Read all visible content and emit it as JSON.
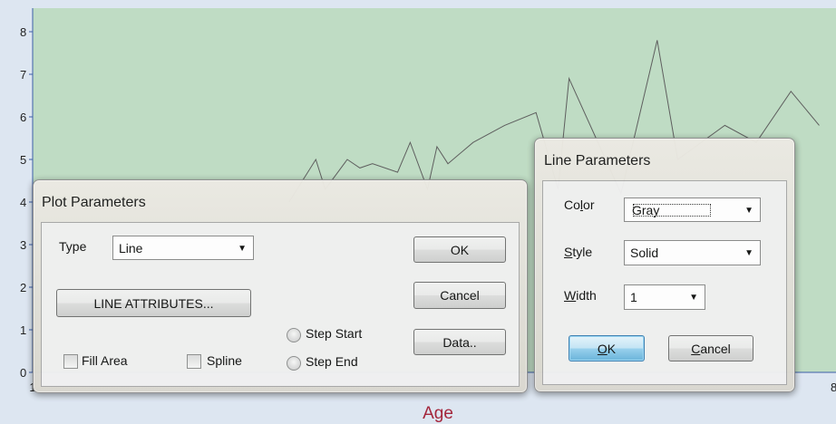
{
  "chart": {
    "xlabel": "Age",
    "y_ticks": [
      "0",
      "1",
      "2",
      "3",
      "4",
      "5",
      "6",
      "7",
      "8"
    ],
    "x_edge_ticks": [
      "1",
      "8"
    ],
    "colors": {
      "plot_bg": "#bfdcc4",
      "outer_bg": "#dde6f1",
      "line": "#5e5e5e",
      "axis": "#3d5fa8",
      "xlabel": "#a4263c"
    }
  },
  "chart_data": {
    "type": "line",
    "xlabel": "Age",
    "ylabel": "",
    "ylim": [
      0,
      8.3
    ],
    "series": [
      {
        "values": [
          [
            9.15,
            4.0
          ],
          [
            10.0,
            5.0
          ],
          [
            10.3,
            4.3
          ],
          [
            11.0,
            5.0
          ],
          [
            11.4,
            4.8
          ],
          [
            11.8,
            4.9
          ],
          [
            12.6,
            4.7
          ],
          [
            13.0,
            5.4
          ],
          [
            13.55,
            4.3
          ],
          [
            13.85,
            5.3
          ],
          [
            14.2,
            4.9
          ],
          [
            15.0,
            5.4
          ],
          [
            16.0,
            5.8
          ],
          [
            17.0,
            6.1
          ],
          [
            17.7,
            4.3
          ],
          [
            18.05,
            6.9
          ],
          [
            19.7,
            4.2
          ],
          [
            20.85,
            7.8
          ],
          [
            21.5,
            5.0
          ],
          [
            23.0,
            5.8
          ],
          [
            24.0,
            5.4
          ],
          [
            25.1,
            6.6
          ],
          [
            26.0,
            5.8
          ]
        ]
      }
    ]
  },
  "plot_params": {
    "title": "Plot Parameters",
    "type_label": "Type",
    "type_value": "Line",
    "line_attr_button": "LINE ATTRIBUTES...",
    "ok": "OK",
    "cancel": "Cancel",
    "data_button": "Data..",
    "fill_area": "Fill Area",
    "spline": "Spline",
    "step_start": "Step Start",
    "step_end": "Step End"
  },
  "line_params": {
    "title": "Line Parameters",
    "color_label_pre": "Co",
    "color_label_mn": "l",
    "color_label_post": "or",
    "color_value": "Gray",
    "style_label_mn": "S",
    "style_label_post": "tyle",
    "style_value": "Solid",
    "width_label_mn": "W",
    "width_label_post": "idth",
    "width_value": "1",
    "ok_mn": "O",
    "ok_post": "K",
    "cancel_mn": "C",
    "cancel_post": "ancel"
  }
}
